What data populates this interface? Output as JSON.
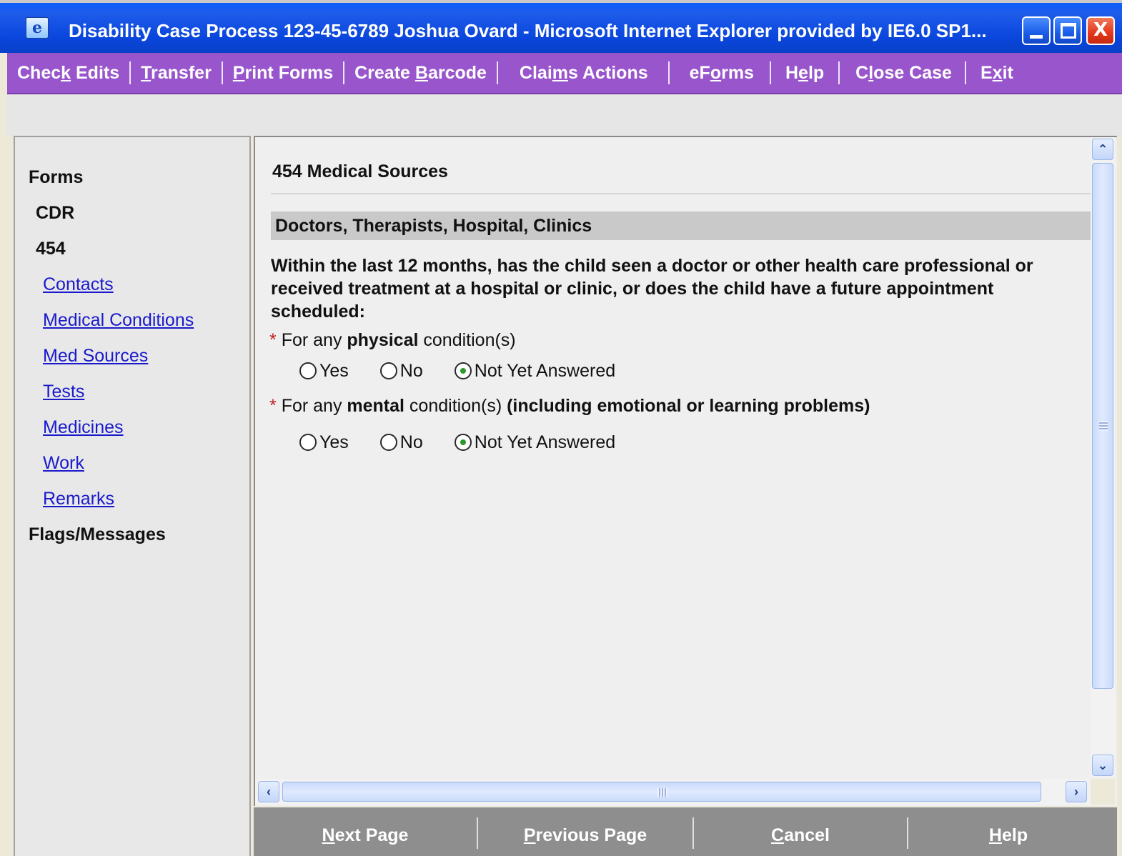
{
  "window": {
    "title": "Disability Case Process 123-45-6789 Joshua Ovard  -  Microsoft Internet Explorer provided by IE6.0 SP1...",
    "icon": "ie-page-icon",
    "controls": {
      "minimize": "minimize-icon",
      "maximize": "maximize-icon",
      "close": "X"
    }
  },
  "menu": {
    "items": [
      {
        "pre": "Chec",
        "accel": "k",
        "post": " Edits"
      },
      {
        "pre": "",
        "accel": "T",
        "post": "ransfer"
      },
      {
        "pre": "",
        "accel": "P",
        "post": "rint Forms"
      },
      {
        "pre": "Create ",
        "accel": "B",
        "post": "arcode"
      },
      {
        "pre": "Clai",
        "accel": "m",
        "post": "s Actions"
      },
      {
        "pre": "eF",
        "accel": "o",
        "post": "rms"
      },
      {
        "pre": "H",
        "accel": "e",
        "post": "lp"
      },
      {
        "pre": "C",
        "accel": "l",
        "post": "ose Case"
      },
      {
        "pre": "E",
        "accel": "x",
        "post": "it"
      }
    ],
    "color": "#9955CC"
  },
  "sidebar": {
    "forms": "Forms",
    "cdr": "CDR",
    "form_454": "454",
    "links": [
      "Contacts",
      "Medical Conditions",
      "Med Sources",
      "Tests",
      "Medicines",
      "Work",
      "Remarks"
    ],
    "flags": "Flags/Messages"
  },
  "main": {
    "title": "454 Medical Sources",
    "section": "Doctors, Therapists, Hospital, Clinics",
    "question": "Within the last 12 months, has the child seen a doctor or other health care professional or received treatment at a hospital or clinic, or does the child have a future appointment scheduled:",
    "physical": {
      "required": "*",
      "pre": "For any ",
      "bold": "physical",
      "post": " condition(s)",
      "options": [
        "Yes",
        "No",
        "Not Yet Answered"
      ],
      "selected": "Not Yet Answered"
    },
    "mental": {
      "required": "*",
      "pre": "For any ",
      "bold": "mental",
      "post": " condition(s) ",
      "bold2": "(including emotional or learning problems)",
      "options": [
        "Yes",
        "No",
        "Not Yet Answered"
      ],
      "selected": "Not Yet Answered"
    }
  },
  "footer": {
    "buttons": [
      {
        "accel": "N",
        "post": "ext Page"
      },
      {
        "accel": "P",
        "post": "revious Page"
      },
      {
        "accel": "C",
        "post": "ancel"
      },
      {
        "accel": "H",
        "post": "elp"
      }
    ]
  }
}
